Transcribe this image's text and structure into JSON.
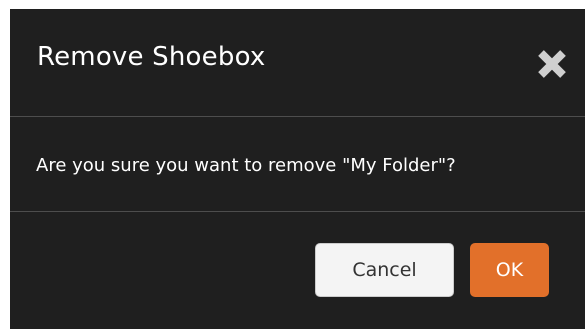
{
  "dialog": {
    "title": "Remove Shoebox",
    "close_icon": "close-icon",
    "message": "Are you sure you want to remove \"My Folder\"?",
    "cancel_label": "Cancel",
    "ok_label": "OK"
  },
  "colors": {
    "dialog_background": "#1f1f1f",
    "divider": "#4d4d4d",
    "text": "#ffffff",
    "close_icon": "#cfcfcf",
    "cancel_background": "#f4f4f4",
    "ok_background": "#e2702a"
  }
}
